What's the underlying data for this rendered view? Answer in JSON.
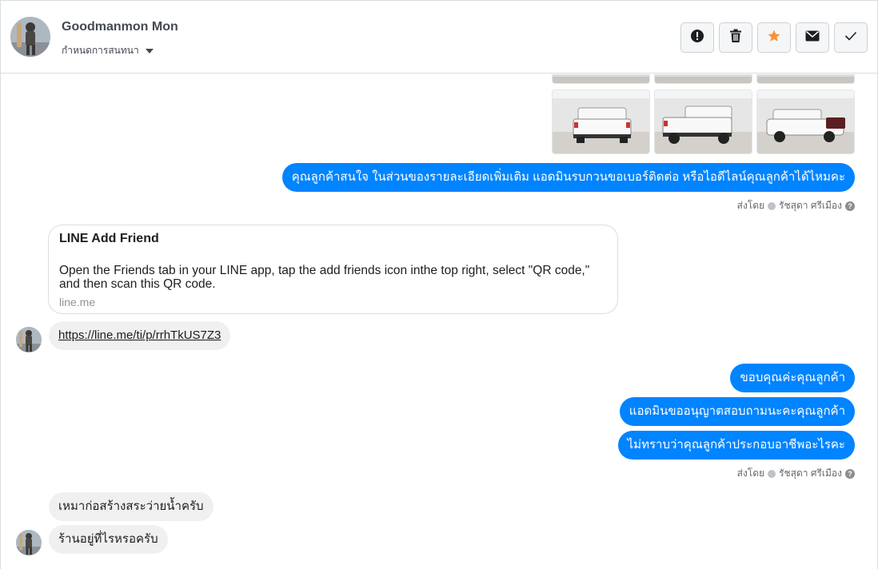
{
  "header": {
    "contact_name": "Goodmanmon Mon",
    "assign_label": "กำหนดการสนทนา",
    "actions": [
      {
        "name": "report-button",
        "icon": "exclamation-icon"
      },
      {
        "name": "delete-button",
        "icon": "trash-icon"
      },
      {
        "name": "star-button",
        "icon": "star-icon"
      },
      {
        "name": "mark-unread-button",
        "icon": "envelope-icon"
      },
      {
        "name": "mark-done-button",
        "icon": "check-icon"
      }
    ]
  },
  "thread": {
    "outgoing_1": "คุณลูกค้าสนใจ ในส่วนของรายละเอียดเพิ่มเติม แอดมินรบกวนขอเบอร์ติดต่อ หรือไอดีไลน์คุณลูกค้าได้ไหมคะ",
    "sent_by_1": "ส่งโดย",
    "sender_name_1": "รัชสุดา ศรีเมือง",
    "link_card": {
      "title": "LINE Add Friend",
      "description": "Open the Friends tab in your LINE app, tap the add friends icon inthe top right, select \"QR code,\" and then scan this QR code.",
      "domain": "line.me"
    },
    "incoming_link": "https://line.me/ti/p/rrhTkUS7Z3",
    "outgoing_2": "ขอบคุณค่ะคุณลูกค้า",
    "outgoing_3": "แอดมินขออนุญาตสอบถามนะคะคุณลูกค้า",
    "outgoing_4": "ไม่ทราบว่าคุณลูกค้าประกอบอาชีพอะไรคะ",
    "sent_by_2": "ส่งโดย",
    "sender_name_2": "รัชสุดา ศรีเมือง",
    "incoming_1": "เหมาก่อสร้างสระว่ายน้ำครับ",
    "incoming_2": "ร้านอยู่ที่ไรหรอครับ"
  },
  "colors": {
    "outgoing_bubble": "#0084ff",
    "incoming_bubble": "#f0f0f0",
    "star_accent": "#f7923b"
  }
}
